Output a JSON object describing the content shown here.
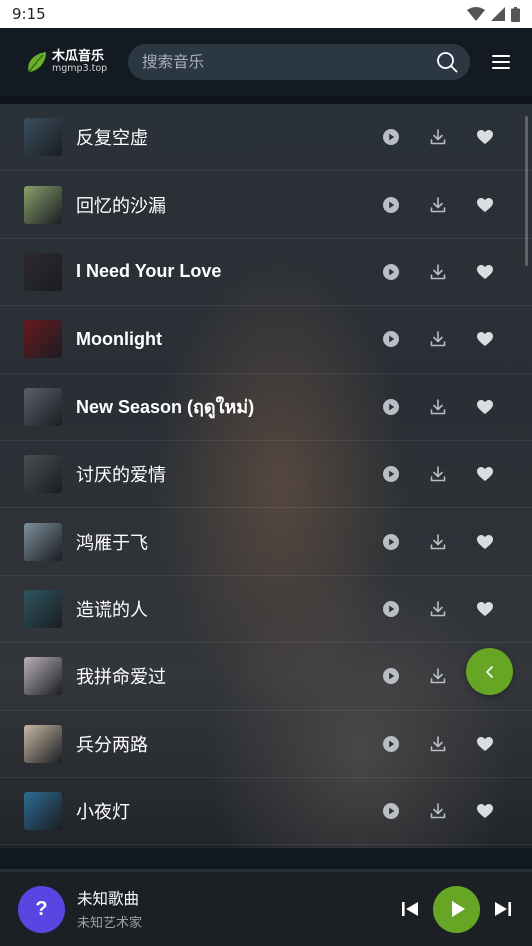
{
  "status_bar": {
    "time": "9:15"
  },
  "header": {
    "logo_title": "木瓜音乐",
    "logo_subtitle": "mgmp3.top",
    "search_placeholder": "搜索音乐"
  },
  "songs": [
    {
      "title": "反复空虚",
      "thumb_color": "#3a4f5e"
    },
    {
      "title": "回忆的沙漏",
      "thumb_color": "#8aa06a"
    },
    {
      "title": "I Need Your Love",
      "thumb_color": "#2d2a2f"
    },
    {
      "title": "Moonlight",
      "thumb_color": "#6a1a1e"
    },
    {
      "title": "New Season (ฤดูใหม่)",
      "thumb_color": "#5b6068"
    },
    {
      "title": "讨厌的爱情",
      "thumb_color": "#4a4d52"
    },
    {
      "title": "鸿雁于飞",
      "thumb_color": "#7e8f9c"
    },
    {
      "title": "造谎的人",
      "thumb_color": "#2f5661"
    },
    {
      "title": "我拼命爱过",
      "thumb_color": "#b9b2b8"
    },
    {
      "title": "兵分两路",
      "thumb_color": "#cab9a5"
    },
    {
      "title": "小夜灯",
      "thumb_color": "#2f6d93"
    }
  ],
  "player": {
    "avatar_text": "?",
    "song": "未知歌曲",
    "artist": "未知艺术家"
  },
  "colors": {
    "accent_green": "#67a524",
    "avatar_purple": "#5b45e2",
    "header_bg": "#141a22"
  }
}
